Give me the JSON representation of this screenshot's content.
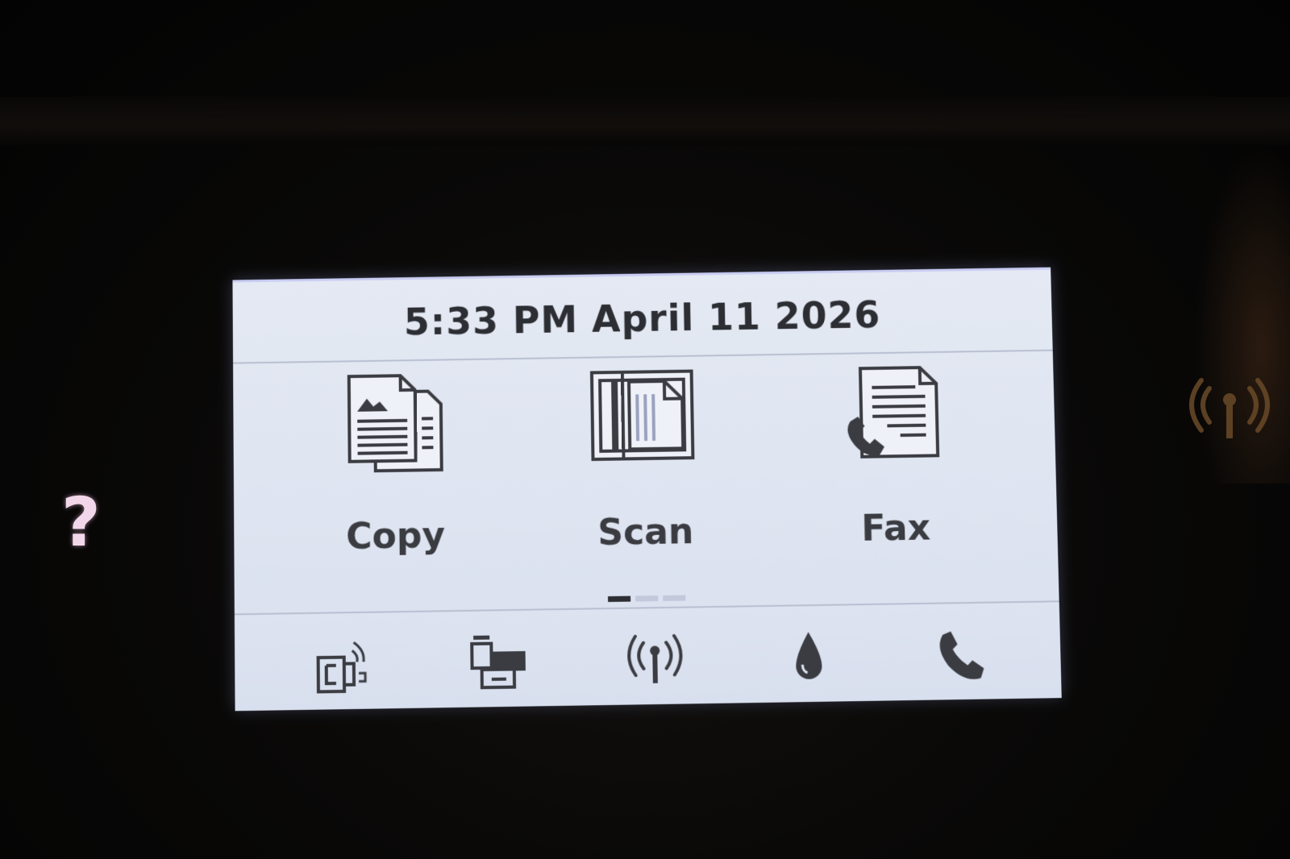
{
  "status": {
    "datetime": "5:33 PM April 11 2026"
  },
  "tiles": [
    {
      "label": "Copy",
      "icon": "copy-icon"
    },
    {
      "label": "Scan",
      "icon": "scan-icon"
    },
    {
      "label": "Fax",
      "icon": "fax-icon"
    }
  ],
  "pager": {
    "pages": 3,
    "current": 1
  },
  "bottom_icons": [
    "wireless-direct-icon",
    "web-services-icon",
    "wireless-icon",
    "ink-icon",
    "fax-status-icon"
  ],
  "panel": {
    "help_glyph": "?",
    "help_icon": "help-icon",
    "wireless_led_icon": "wireless-led-icon"
  },
  "colors": {
    "screen_bg": "#e0e6f2",
    "text": "#2c2e33",
    "bezel": "#050403",
    "help_key": "#f2d7ea",
    "wireless_led": "#6a4a28"
  }
}
